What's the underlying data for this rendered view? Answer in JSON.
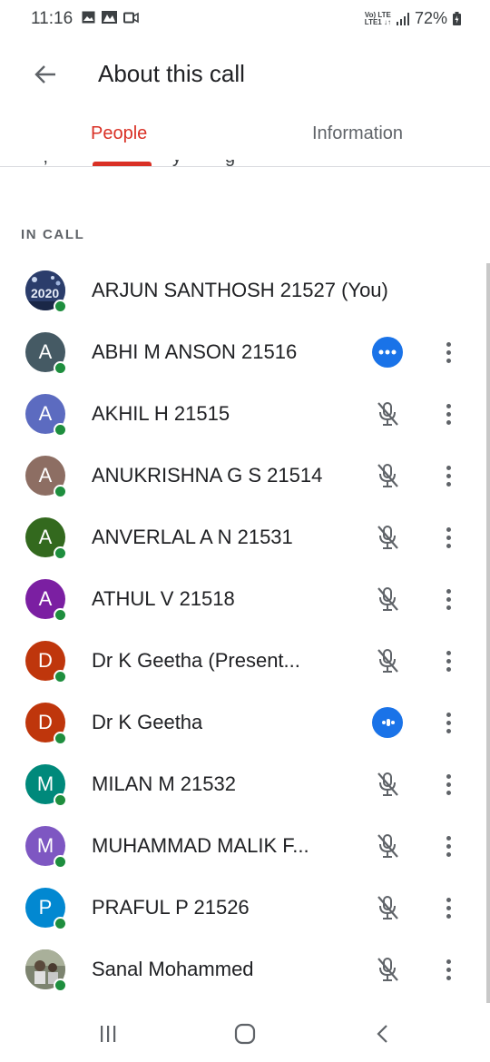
{
  "status_bar": {
    "time": "11:16",
    "net_top": "Vo) LTE",
    "net_bottom": "LTE1 ↓↑",
    "battery_percent": "72%"
  },
  "app_bar": {
    "title": "About this call"
  },
  "tabs": [
    {
      "label": "People",
      "active": true
    },
    {
      "label": "Information",
      "active": false
    }
  ],
  "section": {
    "title": "IN CALL"
  },
  "people": [
    {
      "initial": "",
      "name": "ARJUN SANTHOSH 21527 (You)",
      "avatar_color": "#243b66",
      "status": "none"
    },
    {
      "initial": "A",
      "name": "ABHI M ANSON 21516",
      "avatar_color": "#455a64",
      "status": "speaking"
    },
    {
      "initial": "A",
      "name": "AKHIL H 21515",
      "avatar_color": "#5c6bc0",
      "status": "muted"
    },
    {
      "initial": "A",
      "name": "ANUKRISHNA G S 21514",
      "avatar_color": "#8d6e63",
      "status": "muted"
    },
    {
      "initial": "A",
      "name": "ANVERLAL A N 21531",
      "avatar_color": "#33691e",
      "status": "muted"
    },
    {
      "initial": "A",
      "name": "ATHUL V 21518",
      "avatar_color": "#7b1fa2",
      "status": "muted"
    },
    {
      "initial": "D",
      "name": "Dr K Geetha (Present...",
      "avatar_color": "#bf360c",
      "status": "muted"
    },
    {
      "initial": "D",
      "name": "Dr K Geetha",
      "avatar_color": "#bf360c",
      "status": "speaking"
    },
    {
      "initial": "M",
      "name": "MILAN M 21532",
      "avatar_color": "#00897b",
      "status": "muted"
    },
    {
      "initial": "M",
      "name": "MUHAMMAD MALIK F...",
      "avatar_color": "#7e57c2",
      "status": "muted"
    },
    {
      "initial": "P",
      "name": "PRAFUL P 21526",
      "avatar_color": "#0288d1",
      "status": "muted"
    },
    {
      "initial": "",
      "name": "Sanal Mohammed",
      "avatar_color": "#8a8f7a",
      "status": "muted"
    }
  ],
  "icons": {
    "back": "arrow-left-icon",
    "speaking": "audio-level-icon",
    "muted": "mic-off-icon",
    "more": "more-vert-icon"
  },
  "colors": {
    "accent": "#d93025",
    "speaking": "#1a73e8",
    "presence": "#1e8e3e"
  }
}
